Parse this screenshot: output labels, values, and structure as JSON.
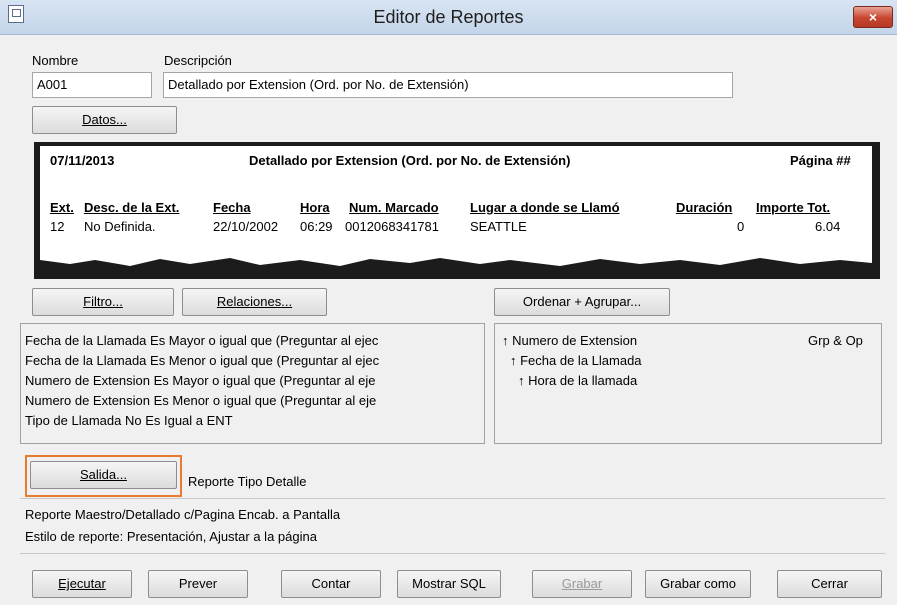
{
  "window": {
    "title": "Editor de Reportes",
    "close_glyph": "×",
    "app_icon": "report-icon",
    "close_color": "#c7452f"
  },
  "fields": {
    "nombre_label": "Nombre",
    "nombre_value": "A001",
    "descripcion_label": "Descripción",
    "descripcion_value": "Detallado por Extension (Ord. por No. de Extensión)"
  },
  "buttons": {
    "datos": "Datos...",
    "filtro": "Filtro...",
    "relaciones": "Relaciones...",
    "ordenar": "Ordenar + Agrupar...",
    "salida": "Salida...",
    "ejecutar": "Ejecutar",
    "prever": "Prever",
    "contar": "Contar",
    "mostrar_sql": "Mostrar SQL",
    "grabar": "Grabar",
    "grabar_como": "Grabar como",
    "cerrar": "Cerrar"
  },
  "preview": {
    "date": "07/11/2013",
    "title": "Detallado por Extension (Ord. por No. de Extensión)",
    "page": "Página ##",
    "columns": [
      "Ext.",
      "Desc. de la Ext.",
      "Fecha",
      "Hora",
      "Num. Marcado",
      "Lugar a donde se Llamó",
      "Duración",
      "Importe Tot."
    ],
    "row": [
      "12",
      "No Definida.",
      "22/10/2002",
      "06:29",
      "0012068341781",
      "SEATTLE",
      "0",
      "6.04"
    ]
  },
  "filters": [
    "Fecha de la Llamada  Es Mayor o igual que (Preguntar al ejec",
    "Fecha de la Llamada  Es Menor o igual que (Preguntar al ejec",
    "Numero de Extension  Es Mayor o igual que (Preguntar al eje",
    "Numero de Extension  Es Menor o igual que (Preguntar al eje",
    "Tipo de Llamada No Es Igual a ENT"
  ],
  "sort": {
    "header_right": "Grp & Op",
    "items": [
      "↑ Numero de Extension",
      "↑ Fecha de la Llamada",
      "↑ Hora de la llamada"
    ]
  },
  "output": {
    "type_label": "Reporte Tipo Detalle",
    "lines": [
      "Reporte Maestro/Detallado c/Pagina Encab. a Pantalla",
      "Estilo de reporte: Presentación, Ajustar a la página"
    ]
  },
  "accent": {
    "highlight": "#ea7a2e"
  }
}
